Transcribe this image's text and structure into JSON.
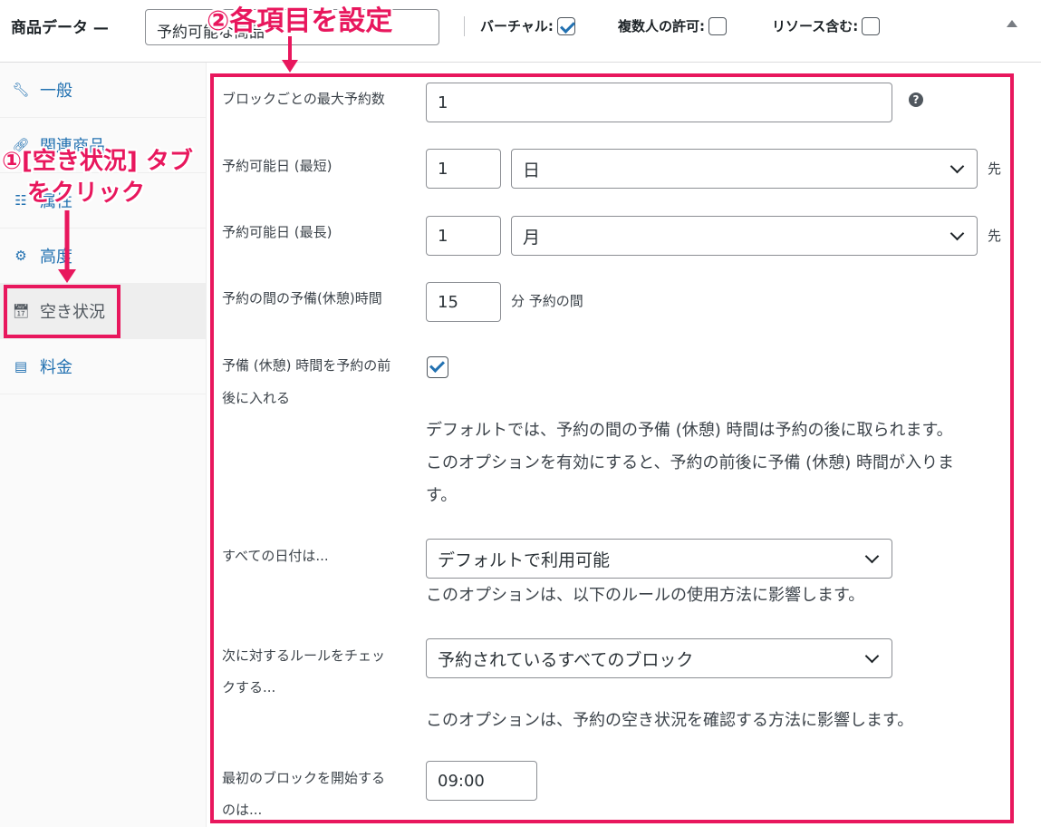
{
  "header": {
    "title": "商品データ —",
    "product_type": "予約可能な商品",
    "options": [
      {
        "label": "バーチャル:",
        "checked": true
      },
      {
        "label": "複数人の許可:",
        "checked": false
      },
      {
        "label": "リソース含む:",
        "checked": false
      }
    ]
  },
  "sidebar": {
    "tabs": [
      {
        "label": "一般",
        "icon": "wrench-icon"
      },
      {
        "label": "関連商品",
        "icon": "link-icon"
      },
      {
        "label": "属性",
        "icon": "list-icon"
      },
      {
        "label": "高度",
        "icon": "gear-icon"
      },
      {
        "label": "空き状況",
        "icon": "calendar-icon"
      },
      {
        "label": "料金",
        "icon": "card-icon"
      }
    ]
  },
  "form": {
    "max_per_block": {
      "label": "ブロックごとの最大予約数",
      "value": "1"
    },
    "min_date": {
      "label": "予約可能日 (最短)",
      "value": "1",
      "unit": "日",
      "suffix": "先"
    },
    "max_date": {
      "label": "予約可能日 (最長)",
      "value": "1",
      "unit": "月",
      "suffix": "先"
    },
    "buffer": {
      "label": "予約の間の予備(休憩)時間",
      "value": "15",
      "suffix": "分 予約の間"
    },
    "adjacent": {
      "label_line1": "予備 (休憩) 時間を予約の前",
      "label_line2": "後に入れる",
      "checked": true,
      "desc_line1": "デフォルトでは、予約の間の予備 (休憩) 時間は予約の後に取られます。",
      "desc_line2": "このオプションを有効にすると、予約の前後に予備 (休憩) 時間が入りま",
      "desc_line3": "す。"
    },
    "all_dates": {
      "label": "すべての日付は...",
      "value": "デフォルトで利用可能",
      "desc": "このオプションは、以下のルールの使用方法に影響します。"
    },
    "check_rules": {
      "label_line1": "次に対するルールをチェッ",
      "label_line2": "クする...",
      "value": "予約されているすべてのブロック",
      "desc": "このオプションは、予約の空き状況を確認する方法に影響します。"
    },
    "first_block": {
      "label_line1": "最初のブロックを開始する",
      "label_line2": "のは...",
      "value": "09:00"
    }
  },
  "annotations": {
    "step1_line1": "①[空き状況] タブ",
    "step1_line2": "をクリック",
    "step2": "②各項目を設定"
  },
  "colors": {
    "accent": "#e8175d",
    "link": "#2271b1"
  }
}
